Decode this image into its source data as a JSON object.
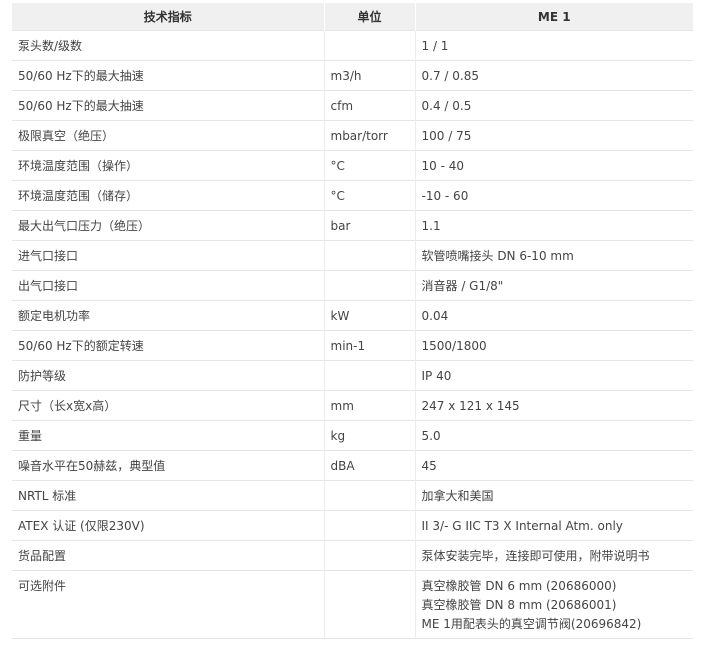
{
  "table": {
    "headers": [
      "技术指标",
      "单位",
      "ME 1"
    ],
    "rows": [
      {
        "name": "泵头数/级数",
        "unit": "",
        "value": "1 / 1"
      },
      {
        "name": "50/60 Hz下的最大抽速",
        "unit": "m3/h",
        "value": "0.7 / 0.85"
      },
      {
        "name": "50/60 Hz下的最大抽速",
        "unit": "cfm",
        "value": "0.4 / 0.5"
      },
      {
        "name": "极限真空（绝压）",
        "unit": "mbar/torr",
        "value": "100 / 75"
      },
      {
        "name": "环境温度范围（操作）",
        "unit": "°C",
        "value": "10 - 40"
      },
      {
        "name": "环境温度范围（储存）",
        "unit": "°C",
        "value": "-10 - 60"
      },
      {
        "name": "最大出气口压力（绝压）",
        "unit": "bar",
        "value": "1.1"
      },
      {
        "name": "进气口接口",
        "unit": "",
        "value": "软管喷嘴接头 DN 6-10 mm"
      },
      {
        "name": "出气口接口",
        "unit": "",
        "value": "消音器 / G1/8\""
      },
      {
        "name": "额定电机功率",
        "unit": "kW",
        "value": "0.04"
      },
      {
        "name": "50/60 Hz下的额定转速",
        "unit": "min-1",
        "value": "1500/1800"
      },
      {
        "name": "防护等级",
        "unit": "",
        "value": "IP 40"
      },
      {
        "name": "尺寸（长x宽x高）",
        "unit": "mm",
        "value": "247 x 121 x 145"
      },
      {
        "name": "重量",
        "unit": "kg",
        "value": "5.0"
      },
      {
        "name": "噪音水平在50赫兹，典型值",
        "unit": "dBA",
        "value": "45"
      },
      {
        "name": "NRTL 标准",
        "unit": "",
        "value": "加拿大和美国"
      },
      {
        "name": "ATEX 认证 (仅限230V)",
        "unit": "",
        "value": "II 3/- G IIC T3 X Internal Atm. only"
      },
      {
        "name": "货品配置",
        "unit": "",
        "value": "泵体安装完毕，连接即可使用，附带说明书"
      }
    ],
    "accessories": {
      "name": "可选附件",
      "unit": "",
      "values": [
        "真空橡胶管 DN 6 mm (20686000)",
        "真空橡胶管 DN 8 mm (20686001)",
        "ME 1用配表头的真空调节阀(20696842)"
      ]
    }
  }
}
